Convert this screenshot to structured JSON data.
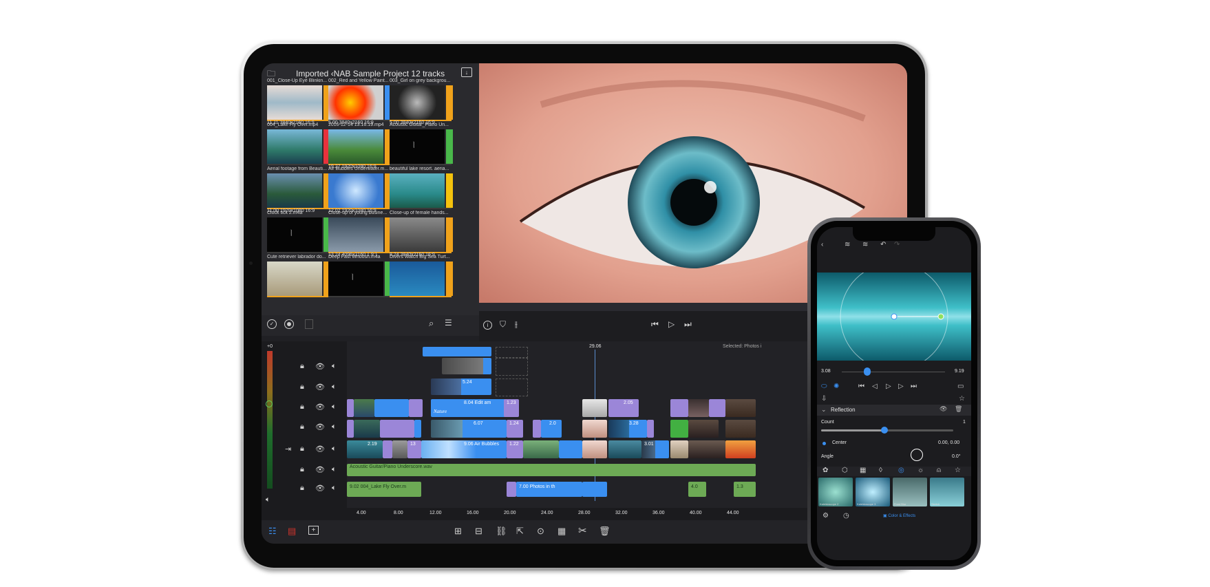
{
  "browser": {
    "title": "Imported ‹NAB Sample Project 12 tracks",
    "items": [
      {
        "name": "001_Close-Up Eye Blinkin...",
        "meta": "11.11  3840x2160  16:9",
        "tag": "#f0a21b"
      },
      {
        "name": "002_Red and Yellow Paint...",
        "meta": "5.00  3840x2160  16:9",
        "tag": "#3a8ff0"
      },
      {
        "name": "003_Girl on grey backgrou...",
        "meta": "5.00  3840x2160  16:9",
        "tag": "#f0a21b"
      },
      {
        "name": "004_Lake Fly Over.mp4",
        "meta": "",
        "tag": "#e8323c"
      },
      {
        "name": "2016-12-14 13.16.19.mp4",
        "meta": "19.27  1920x1080  16:9",
        "tag": "#f0a21b"
      },
      {
        "name": "Acoustic Guitar_Piano Un...",
        "meta": "",
        "tag": "#49b84a"
      },
      {
        "name": "Aerial footage from Beauti...",
        "meta": "11.00  1920x1080  16:9",
        "tag": "#f0a21b"
      },
      {
        "name": "Air Bubbles Underwater.m...",
        "meta": "12.02  1920x1080  16:9",
        "tag": "#f0a21b"
      },
      {
        "name": "beautiful lake resort. aeria...",
        "meta": "",
        "tag": "#f4c20d"
      },
      {
        "name": "Clock tick 2.m4a",
        "meta": "",
        "tag": "#49b84a"
      },
      {
        "name": "Close-up of young busine...",
        "meta": "13.24  4096x2160  1.9:1",
        "tag": "#f0a21b"
      },
      {
        "name": "Close-up of female hands...",
        "meta": "8.24  3840x2160  16:9",
        "tag": "#f0a21b"
      },
      {
        "name": "Cute retriever labrador do...",
        "meta": "",
        "tag": "#f0a21b"
      },
      {
        "name": "Deep Fast Whoosh.m4a",
        "meta": "",
        "tag": "#49b84a"
      },
      {
        "name": "Divers Watch Big Sea Turt...",
        "meta": "",
        "tag": "#f0a21b"
      }
    ]
  },
  "timeline": {
    "level_top": "+0",
    "playhead_time": "29.06",
    "selected_text": "Selected: Photos i",
    "ruler": [
      "4.00",
      "8.00",
      "12.00",
      "16.00",
      "20.00",
      "24.00",
      "28.00",
      "32.00",
      "36.00",
      "40.00",
      "44.00"
    ],
    "clips": {
      "nature": "Nature",
      "edit": "8.04   Edit am",
      "edit_dur": "1.23",
      "c607": "6.07",
      "c124": "1.24",
      "c524": "5.24",
      "air_bubbles": "9.06    Air Bubbles",
      "c122": "1.22",
      "c219": "2.19",
      "c13": "13",
      "c205": "2.05",
      "c328": "3.28",
      "c301": "3.01",
      "c20": "2.0",
      "acoustic": "Acoustic Guitar/Piano Underscore.wav",
      "lake": "9.02    004_Lake Fly Over.m",
      "photos": "7.00    Photos in th",
      "c13b": "1.3",
      "c40": "4.0"
    }
  },
  "phone": {
    "time_left": "3.08",
    "time_right": "9.19",
    "effect_name": "Reflection",
    "count_label": "Count",
    "count_value": "1",
    "count_fraction": 0.48,
    "center_label": "Center",
    "center_value": "0.00, 0.00",
    "angle_label": "Angle",
    "angle_value": "0.0°",
    "presets": [
      "Kaleidoscope 2",
      "Kaleidoscope 3",
      "Frost Blur",
      "Sketch"
    ],
    "tab_label": "Color & Effects"
  }
}
